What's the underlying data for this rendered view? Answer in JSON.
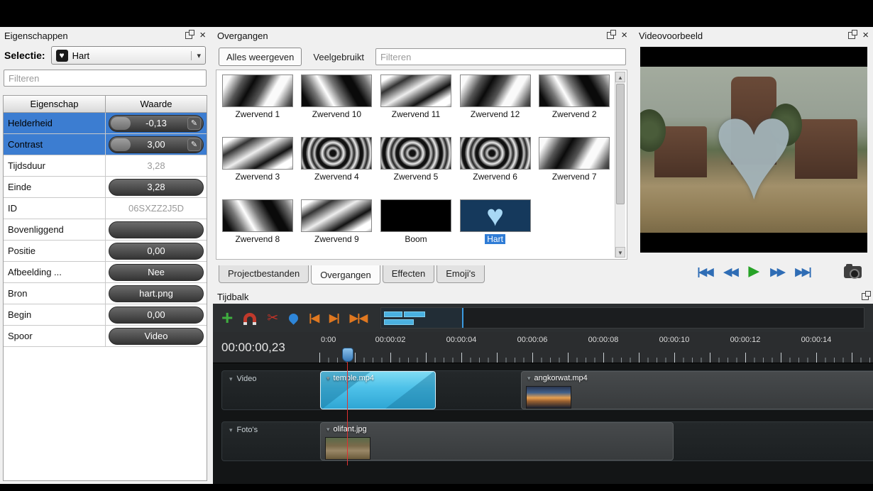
{
  "colors": {
    "selection_blue": "#3c7dd1",
    "clip_selected_cyan": "#4cc0e8",
    "play_green": "#27a327",
    "toolbar_orange": "#e07820",
    "danger_red": "#c23328",
    "panel_bg": "#f0f0f0",
    "timeline_bg": "#131516"
  },
  "icons": {
    "close": "×",
    "dropdown": "▾",
    "collapse": "▾",
    "edit": "✎",
    "scroll_up": "▲",
    "scroll_down": "▼",
    "plus": "+",
    "scissors": "✂",
    "marker_prev": "|◀",
    "marker_next": "▶|",
    "center_playhead": "▶|◀",
    "jump_start": "|◀◀",
    "rewind": "◀◀",
    "play": "▶",
    "forward": "▶▶",
    "jump_end": "▶▶|",
    "heart": "♥"
  },
  "properties": {
    "title": "Eigenschappen",
    "selection_label": "Selectie:",
    "selection_value": "Hart",
    "filter_placeholder": "Filteren",
    "table": {
      "header_property": "Eigenschap",
      "header_value": "Waarde",
      "rows": [
        {
          "name": "Helderheid",
          "value": "-0,13"
        },
        {
          "name": "Contrast",
          "value": "3,00"
        },
        {
          "name": "Tijdsduur",
          "value": "3,28"
        },
        {
          "name": "Einde",
          "value": "3,28"
        },
        {
          "name": "ID",
          "value": "06SXZZ2J5D"
        },
        {
          "name": "Bovenliggend",
          "value": ""
        },
        {
          "name": "Positie",
          "value": "0,00"
        },
        {
          "name": "Afbeelding ...",
          "value": "Nee"
        },
        {
          "name": "Bron",
          "value": "hart.png"
        },
        {
          "name": "Begin",
          "value": "0,00"
        },
        {
          "name": "Spoor",
          "value": "Video"
        }
      ]
    }
  },
  "transitions": {
    "title": "Overgangen",
    "tabs": {
      "all": "Alles weergeven",
      "common": "Veelgebruikt"
    },
    "filter_placeholder": "Filteren",
    "items": [
      {
        "name": "Zwervend 1"
      },
      {
        "name": "Zwervend 10"
      },
      {
        "name": "Zwervend 11"
      },
      {
        "name": "Zwervend 12"
      },
      {
        "name": "Zwervend 2"
      },
      {
        "name": "Zwervend 3"
      },
      {
        "name": "Zwervend 4"
      },
      {
        "name": "Zwervend 5"
      },
      {
        "name": "Zwervend 6"
      },
      {
        "name": "Zwervend 7"
      },
      {
        "name": "Zwervend 8"
      },
      {
        "name": "Zwervend 9"
      },
      {
        "name": "Boom"
      },
      {
        "name": "Hart"
      }
    ],
    "bottom_tabs": {
      "project": "Projectbestanden",
      "transitions": "Overgangen",
      "effects": "Effecten",
      "emoji": "Emoji's"
    }
  },
  "preview": {
    "title": "Videovoorbeeld"
  },
  "timeline": {
    "title": "Tijdbalk",
    "timecode": "00:00:00,23",
    "ruler_labels": [
      "0:00",
      "00:00:02",
      "00:00:04",
      "00:00:06",
      "00:00:08",
      "00:00:10",
      "00:00:12",
      "00:00:14"
    ],
    "tracks": [
      {
        "name": "Video"
      },
      {
        "name": "Foto's"
      }
    ],
    "clips": {
      "temple": "temple.mp4",
      "angkor": "angkorwat.mp4",
      "olifant": "olifant.jpg"
    }
  }
}
